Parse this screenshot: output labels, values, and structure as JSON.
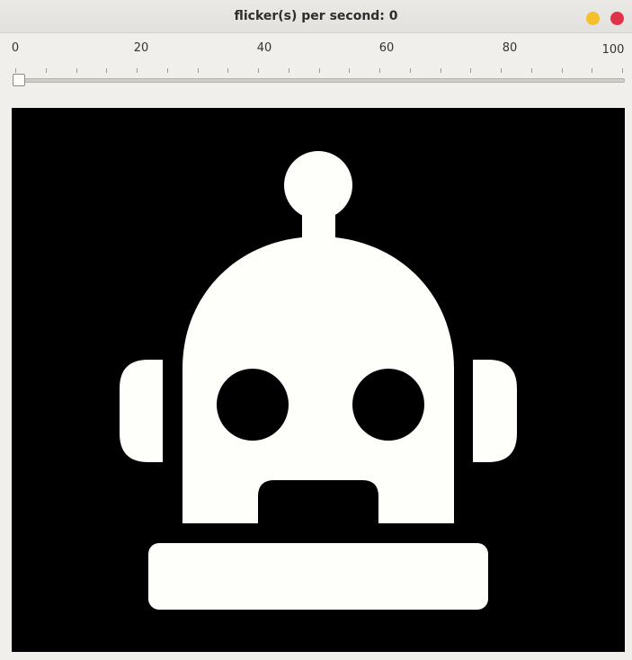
{
  "window": {
    "title": "flicker(s) per second: 0",
    "buttons": [
      "minimize",
      "close"
    ]
  },
  "slider": {
    "value": 0,
    "min": 0,
    "max": 100,
    "tick_labels": [
      "0",
      "20",
      "40",
      "60",
      "80",
      "100"
    ]
  },
  "canvas": {
    "background": "#000000",
    "foreground": "#fefefa",
    "icon": "robot-head-icon"
  }
}
